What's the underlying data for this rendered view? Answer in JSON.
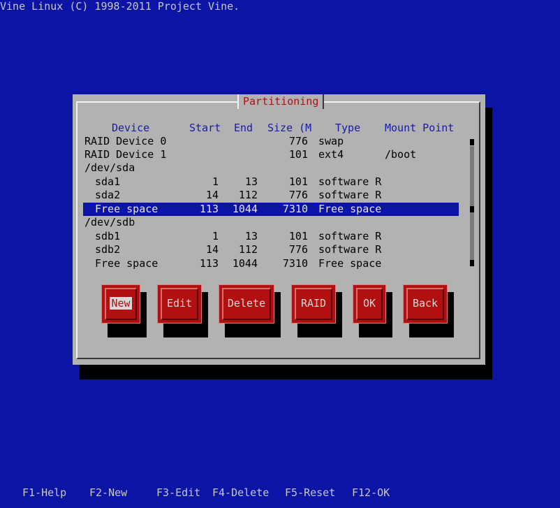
{
  "top_title": "Vine Linux (C) 1998-2011 Project Vine.",
  "dialog": {
    "title": "Partitioning"
  },
  "table": {
    "headers": {
      "device": "Device",
      "start": "Start",
      "end": "End",
      "size": "Size (M",
      "type": "Type",
      "mount": "Mount Point"
    },
    "rows": [
      {
        "device": "RAID Device 0",
        "start": "",
        "end": "",
        "size": "776",
        "type": "swap",
        "mount": ""
      },
      {
        "device": "RAID Device 1",
        "start": "",
        "end": "",
        "size": "101",
        "type": "ext4",
        "mount": "/boot"
      },
      {
        "device": "/dev/sda",
        "start": "",
        "end": "",
        "size": "",
        "type": "",
        "mount": ""
      },
      {
        "device": "sda1",
        "start": "1",
        "end": "13",
        "size": "101",
        "type": "software R",
        "mount": ""
      },
      {
        "device": "sda2",
        "start": "14",
        "end": "112",
        "size": "776",
        "type": "software R",
        "mount": ""
      },
      {
        "device": "Free space",
        "start": "113",
        "end": "1044",
        "size": "7310",
        "type": "Free space",
        "mount": ""
      },
      {
        "device": "/dev/sdb",
        "start": "",
        "end": "",
        "size": "",
        "type": "",
        "mount": ""
      },
      {
        "device": "sdb1",
        "start": "1",
        "end": "13",
        "size": "101",
        "type": "software R",
        "mount": ""
      },
      {
        "device": "sdb2",
        "start": "14",
        "end": "112",
        "size": "776",
        "type": "software R",
        "mount": ""
      },
      {
        "device": "Free space",
        "start": "113",
        "end": "1044",
        "size": "7310",
        "type": "Free space",
        "mount": ""
      }
    ],
    "selected_row_index": 5
  },
  "buttons": {
    "new": "New",
    "edit": "Edit",
    "delete": "Delete",
    "raid": "RAID",
    "ok": "OK",
    "back": "Back",
    "focused": "new"
  },
  "function_keys": [
    "F1-Help",
    "F2-New",
    "F3-Edit",
    "F4-Delete",
    "F5-Reset",
    "F12-OK"
  ],
  "colors": {
    "background": "#0b14a4",
    "dialog": "#b2b2b2",
    "button": "#b01010",
    "title_text": "#b01010",
    "header_text": "#1a1aa6",
    "selection": "#0b14a4"
  }
}
